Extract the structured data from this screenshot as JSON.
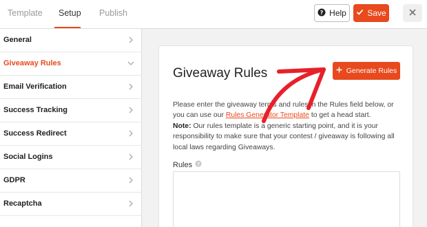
{
  "header": {
    "tabs": [
      {
        "label": "Template"
      },
      {
        "label": "Setup"
      },
      {
        "label": "Publish"
      }
    ],
    "help_label": "Help",
    "save_label": "Save"
  },
  "sidebar": {
    "items": [
      {
        "label": "General"
      },
      {
        "label": "Giveaway Rules"
      },
      {
        "label": "Email Verification"
      },
      {
        "label": "Success Tracking"
      },
      {
        "label": "Success Redirect"
      },
      {
        "label": "Social Logins"
      },
      {
        "label": "GDPR"
      },
      {
        "label": "Recaptcha"
      }
    ]
  },
  "main": {
    "title": "Giveaway Rules",
    "generate_label": "Generate Rules",
    "desc": {
      "part1": "Please enter the giveaway terms and rules in the Rules field below, or you can use our ",
      "link": "Rules Generator Template",
      "part2": " to get a head start.",
      "note_label": "Note:",
      "note_text": " Our rules template is a generic starting point, and it is your responsibility to make sure that your contest / giveaway is following all local laws regarding Giveaways."
    },
    "rules_label": "Rules"
  },
  "colors": {
    "accent": "#e8491d",
    "annotation_arrow": "#e8202b"
  }
}
